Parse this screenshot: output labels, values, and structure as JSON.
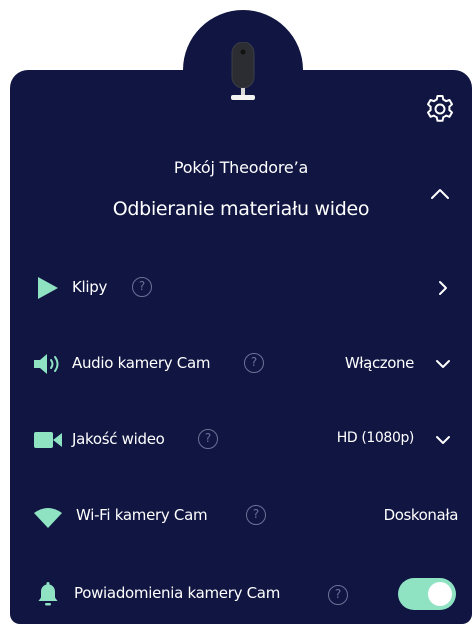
{
  "header": {
    "room_name": "Pokój Theodore’a",
    "stream_status": "Odbieranie materiału wideo"
  },
  "rows": {
    "clips": {
      "label": "Klipy",
      "help": "?"
    },
    "audio": {
      "label": "Audio kamery Cam",
      "help": "?",
      "value": "Włączone"
    },
    "quality": {
      "label": "Jakość wideo",
      "help": "?",
      "value": "HD (1080p)"
    },
    "wifi": {
      "label": "Wi-Fi kamery Cam",
      "help": "?",
      "value": "Doskonała"
    },
    "notifications": {
      "label": "Powiadomienia kamery Cam",
      "help": "?",
      "enabled": true
    }
  },
  "colors": {
    "panel": "#101542",
    "accent": "#8fe3c3",
    "help_ring": "#6d7196",
    "text": "#ffffff"
  },
  "icons": {
    "device": "camera-device-icon",
    "settings": "gear-icon",
    "collapse": "chevron-up-icon",
    "clips": "play-icon",
    "audio": "speaker-icon",
    "quality": "video-camera-icon",
    "wifi": "wifi-icon",
    "notifications": "bell-icon"
  }
}
